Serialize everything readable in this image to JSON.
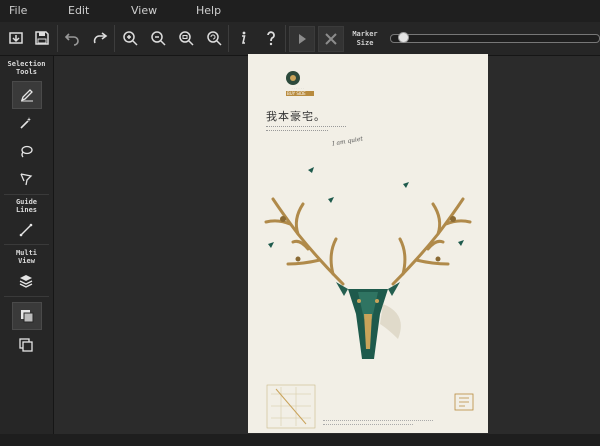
{
  "menu": {
    "file": "File",
    "edit": "Edit",
    "view": "View",
    "help": "Help"
  },
  "toolbar": {
    "marker_size_label": "Marker\nSize",
    "marker_size_value": 0.05,
    "buttons": [
      "open-folder-icon",
      "save-icon",
      "undo-icon",
      "redo-icon",
      "zoom-in-icon",
      "zoom-out-icon",
      "zoom-fit-icon",
      "zoom-reset-icon",
      "info-icon",
      "help-icon",
      "play-icon",
      "close-icon"
    ]
  },
  "sidebar": {
    "selection_tools": "Selection\nTools",
    "guide_lines": "Guide\nLines",
    "multi_view": "Multi\nView"
  },
  "poster": {
    "brand_name": "BUY SIDE",
    "headline": "我本豪宅。",
    "signature": "I am quiet",
    "colors": {
      "background": "#f2efe6",
      "antler": "#b08a4a",
      "deer_green": "#1e5a4c",
      "gold_text": "#b88b3e"
    }
  }
}
